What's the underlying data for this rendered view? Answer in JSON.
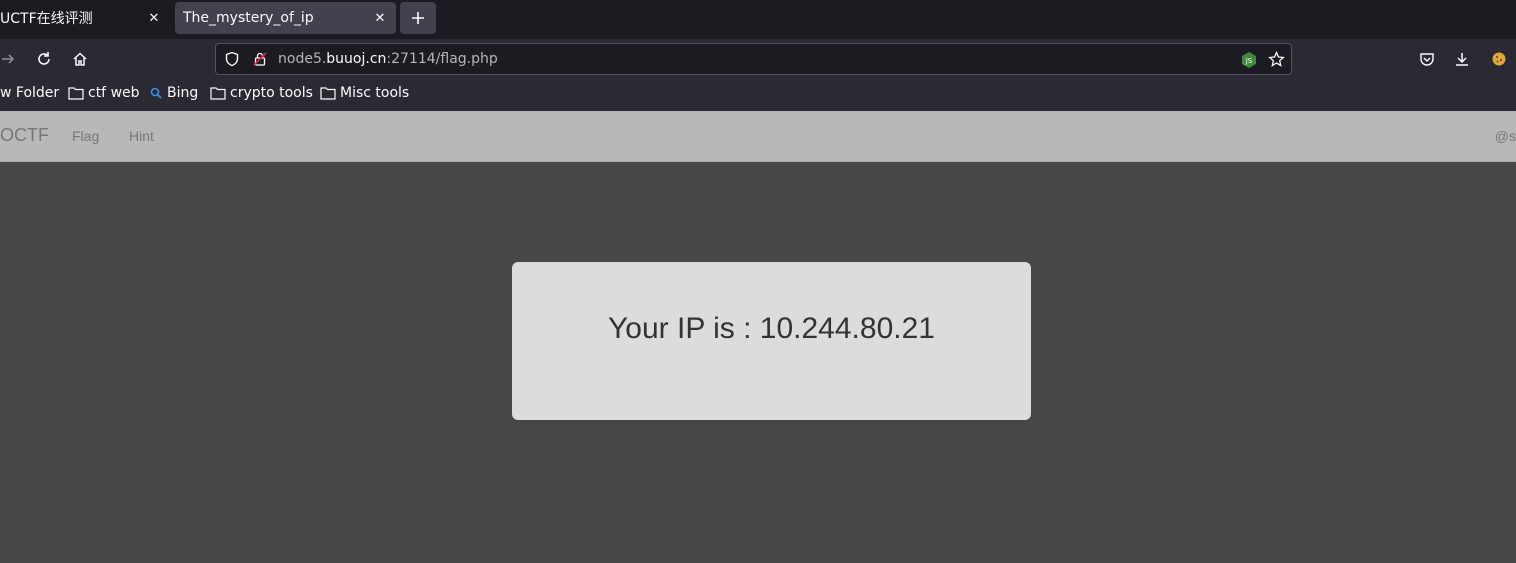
{
  "tabs": [
    {
      "title": "UCTF在线评测",
      "active": false
    },
    {
      "title": "The_mystery_of_ip",
      "active": true
    }
  ],
  "url": {
    "subdomain": "node5.",
    "host": "buuoj.cn",
    "rest": ":27114/flag.php"
  },
  "bookmarks": [
    {
      "label": "w Folder",
      "icon": "folder-icon"
    },
    {
      "label": "ctf web",
      "icon": "folder-icon"
    },
    {
      "label": "Bing",
      "icon": "search-icon"
    },
    {
      "label": "crypto tools",
      "icon": "folder-icon"
    },
    {
      "label": "Misc tools",
      "icon": "folder-icon"
    }
  ],
  "site": {
    "brand": "OCTF",
    "links": [
      "Flag",
      "Hint"
    ],
    "right": "@s"
  },
  "content": {
    "ip_message": "Your IP is : 10.244.80.21"
  },
  "colors": {
    "tab_bg": "#1c1b22",
    "toolbar_bg": "#2b2a33",
    "site_nav": "#b8b8b8",
    "page_bg": "#474747",
    "jumbotron": "#dcdcdc"
  }
}
